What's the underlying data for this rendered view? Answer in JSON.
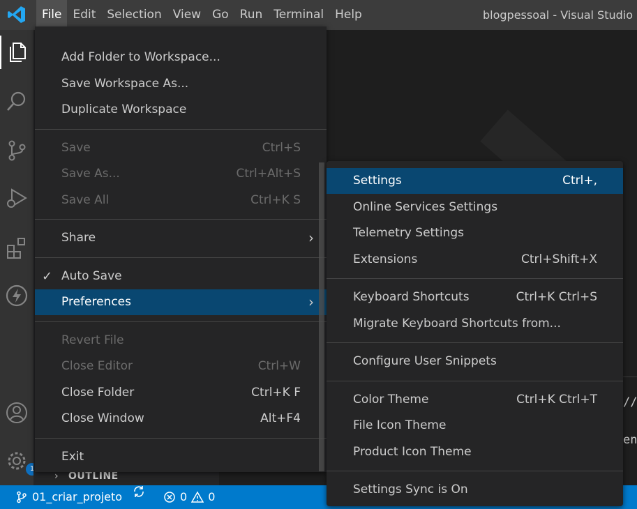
{
  "menubar": {
    "items": [
      "File",
      "Edit",
      "Selection",
      "View",
      "Go",
      "Run",
      "Terminal",
      "Help"
    ],
    "active": "File"
  },
  "window_title": "blogpessoal - Visual Studio",
  "file_menu": {
    "groups": [
      [
        {
          "label": "Add Folder to Workspace..."
        },
        {
          "label": "Save Workspace As..."
        },
        {
          "label": "Duplicate Workspace"
        }
      ],
      [
        {
          "label": "Save",
          "key": "Ctrl+S",
          "disabled": true
        },
        {
          "label": "Save As...",
          "key": "Ctrl+Alt+S",
          "disabled": true
        },
        {
          "label": "Save All",
          "key": "Ctrl+K S",
          "disabled": true
        }
      ],
      [
        {
          "label": "Share",
          "submenu": true
        }
      ],
      [
        {
          "label": "Auto Save",
          "checked": true
        },
        {
          "label": "Preferences",
          "submenu": true,
          "highlighted": true
        }
      ],
      [
        {
          "label": "Revert File",
          "disabled": true
        },
        {
          "label": "Close Editor",
          "key": "Ctrl+W",
          "disabled": true
        },
        {
          "label": "Close Folder",
          "key": "Ctrl+K F"
        },
        {
          "label": "Close Window",
          "key": "Alt+F4"
        }
      ],
      [
        {
          "label": "Exit"
        }
      ]
    ]
  },
  "preferences_menu": {
    "groups": [
      [
        {
          "label": "Settings",
          "key": "Ctrl+,",
          "highlighted": true
        },
        {
          "label": "Online Services Settings"
        },
        {
          "label": "Telemetry Settings"
        },
        {
          "label": "Extensions",
          "key": "Ctrl+Shift+X"
        }
      ],
      [
        {
          "label": "Keyboard Shortcuts",
          "key": "Ctrl+K Ctrl+S"
        },
        {
          "label": "Migrate Keyboard Shortcuts from..."
        }
      ],
      [
        {
          "label": "Configure User Snippets"
        }
      ],
      [
        {
          "label": "Color Theme",
          "key": "Ctrl+K Ctrl+T"
        },
        {
          "label": "File Icon Theme"
        },
        {
          "label": "Product Icon Theme"
        }
      ],
      [
        {
          "label": "Settings Sync is On"
        }
      ]
    ]
  },
  "activity_bar": {
    "icons": [
      "files-icon",
      "search-icon",
      "source-control-icon",
      "run-debug-icon",
      "extensions-icon",
      "thunder-client-icon",
      "account-icon",
      "manage-gear-icon"
    ],
    "badge": "1"
  },
  "sidebar": {
    "outline_label": "OUTLINE"
  },
  "panel": {
    "text1": "//",
    "text2": "en"
  },
  "statusbar": {
    "branch": "01_criar_projeto",
    "errors": "0",
    "warnings": "0"
  },
  "colors": {
    "accent": "#007acc",
    "highlight": "#094771",
    "menu_bg": "#252526"
  }
}
